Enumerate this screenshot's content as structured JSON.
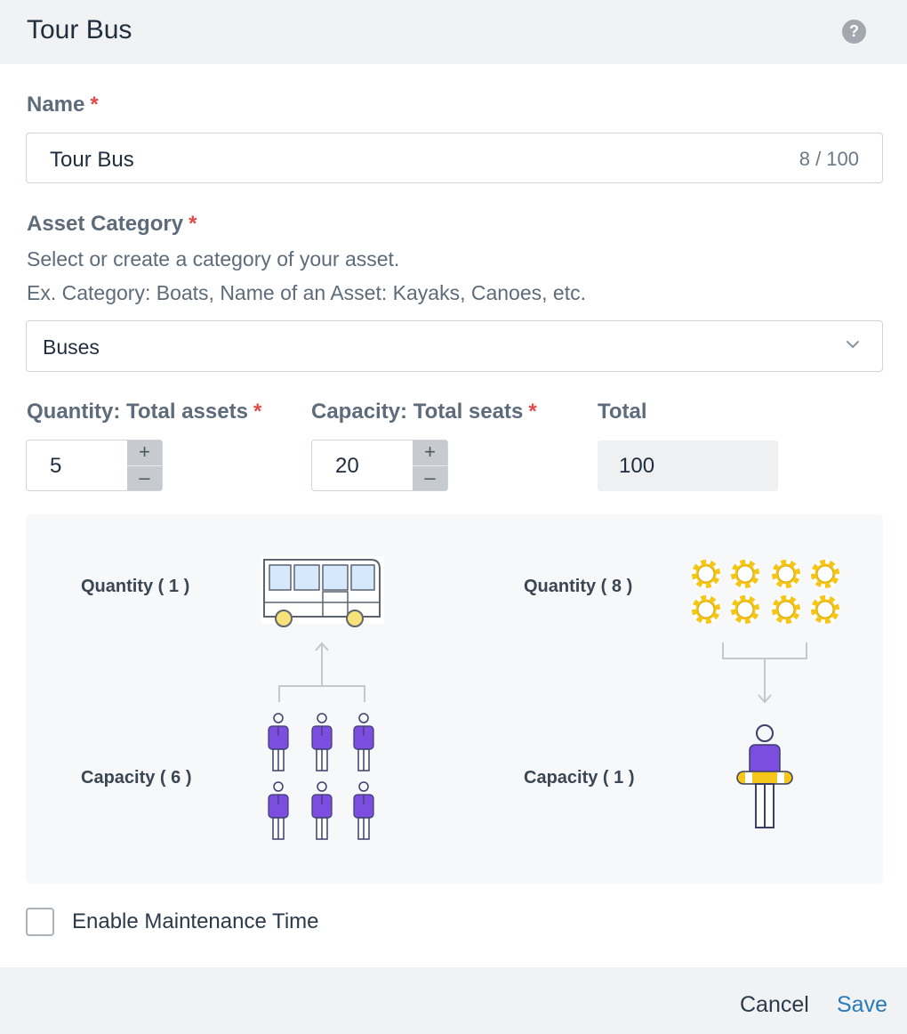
{
  "dialog": {
    "title": "Tour Bus",
    "help_icon": "question-circle-icon",
    "help_glyph": "?"
  },
  "name_field": {
    "label": "Name",
    "required_mark": "*",
    "value": "Tour Bus",
    "counter": "8 / 100"
  },
  "category": {
    "label": "Asset Category",
    "required_mark": "*",
    "help_line1": "Select or create a category of your asset.",
    "help_line2": "Ex. Category: Boats, Name of an Asset: Kayaks, Canoes, etc.",
    "selected": "Buses",
    "dropdown_icon": "chevron-down-icon"
  },
  "quantity": {
    "label": "Quantity: Total assets",
    "required_mark": "*",
    "value": "5",
    "plus": "+",
    "minus": "–"
  },
  "capacity": {
    "label": "Capacity: Total seats",
    "required_mark": "*",
    "value": "20",
    "plus": "+",
    "minus": "–"
  },
  "total": {
    "label": "Total",
    "value": "100"
  },
  "illustration": {
    "left": {
      "quantity_label": "Quantity ( 1 )",
      "capacity_label": "Capacity ( 6 )",
      "asset_icon": "bus-icon",
      "person_icon": "person-icon"
    },
    "right": {
      "quantity_label": "Quantity ( 8 )",
      "capacity_label": "Capacity ( 1 )",
      "asset_icon": "life-ring-icon",
      "person_icon": "person-with-life-ring-icon"
    },
    "colors": {
      "person": "#7c4dde",
      "ring": "#f5c518",
      "bus_window": "#d6e8fb",
      "arrow": "#c3c8cd"
    }
  },
  "maintenance": {
    "label": "Enable Maintenance Time",
    "checked": false
  },
  "footer": {
    "cancel": "Cancel",
    "save": "Save"
  }
}
